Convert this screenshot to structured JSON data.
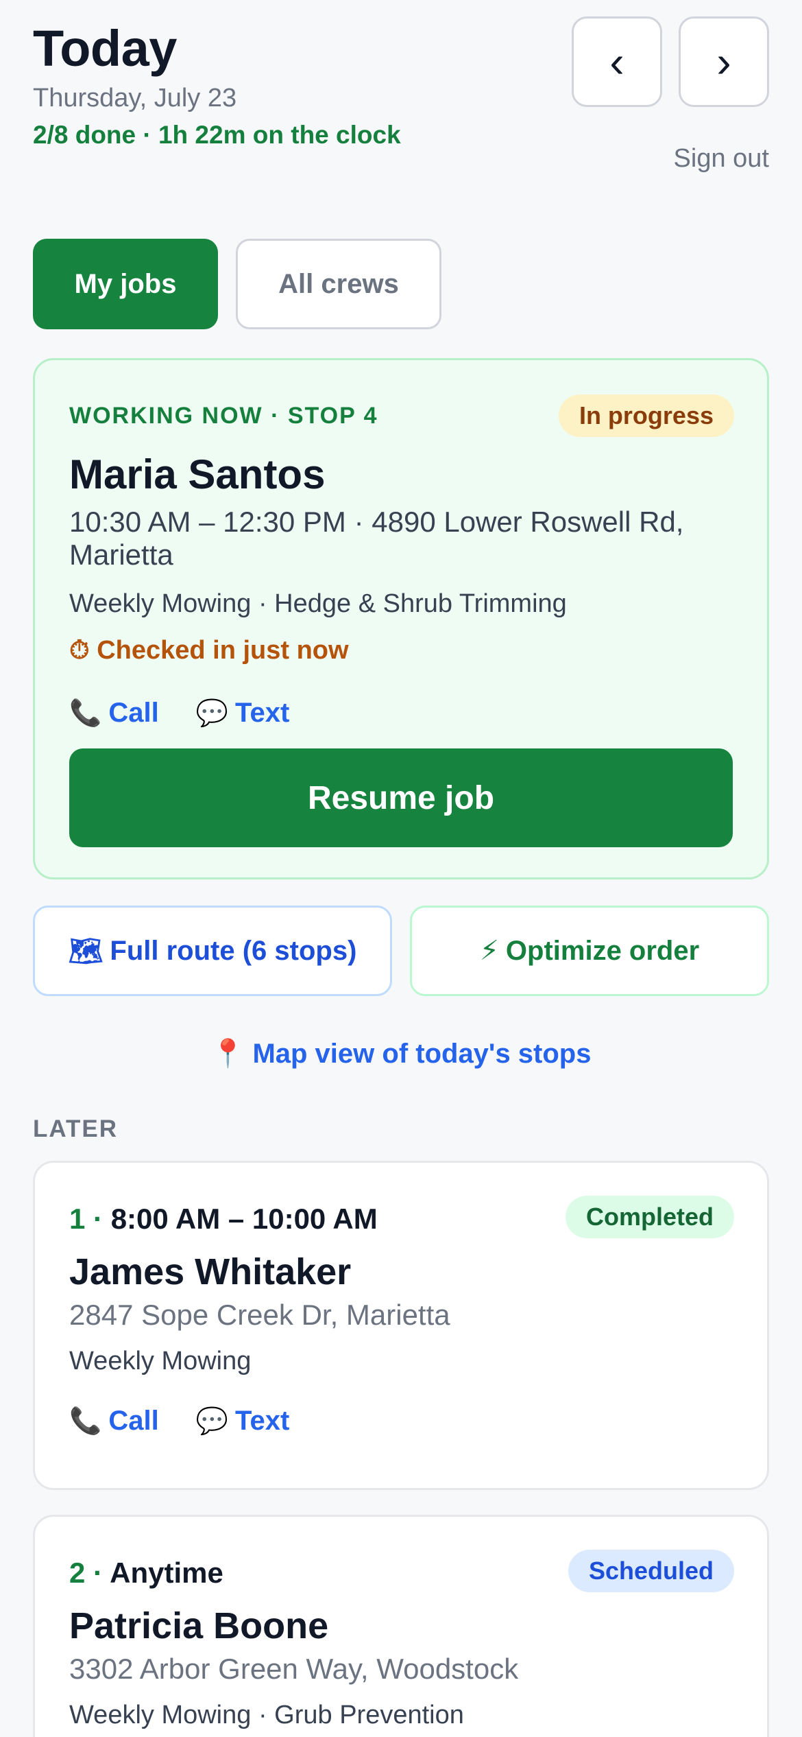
{
  "header": {
    "title": "Today",
    "date": "Thursday, July 23",
    "summary": "2/8 done · 1h 22m on the clock",
    "prev_label": "‹",
    "next_label": "›",
    "signout_label": "Sign out"
  },
  "view_toggle": {
    "active": "My jobs",
    "items": [
      "My jobs",
      "All crews"
    ]
  },
  "current_job": {
    "label": "WORKING NOW · STOP 4",
    "status": "In progress",
    "customer": "Maria Santos",
    "time_address": "10:30 AM – 12:30 PM · 4890 Lower Roswell Rd, Marietta",
    "services": "Weekly Mowing · Hedge & Shrub Trimming",
    "checkin": "⏱ Checked in just now",
    "call_label": "Call",
    "text_label": "Text",
    "call_icon": "phone-icon",
    "text_icon": "speech-bubble-icon",
    "action_label": "Resume job"
  },
  "route_actions": {
    "full_route_icon": "🗺",
    "full_route_label": "Full route (6 stops)",
    "optimize_icon": "⚡",
    "optimize_label": "Optimize order",
    "map_icon": "📍",
    "map_label": "Map view of today's stops"
  },
  "later": {
    "section_label": "LATER",
    "jobs": [
      {
        "number": "1 ·",
        "time": "8:00 AM – 10:00 AM",
        "status": "Completed",
        "customer": "James Whitaker",
        "address": "2847 Sope Creek Dr, Marietta",
        "services": "Weekly Mowing",
        "call_label": "Call",
        "text_label": "Text"
      },
      {
        "number": "2 ·",
        "time": "Anytime",
        "status": "Scheduled",
        "customer": "Patricia Boone",
        "address": "3302 Arbor Green Way, Woodstock",
        "services": "Weekly Mowing · Grub Prevention"
      }
    ]
  },
  "colors": {
    "primary_green": "#16833e",
    "link_blue": "#2563eb",
    "progress_badge_bg": "#fdf2c5",
    "completed_badge_bg": "#dcfce7",
    "scheduled_badge_bg": "#dbeafe",
    "current_card_bg": "#effcf3"
  }
}
